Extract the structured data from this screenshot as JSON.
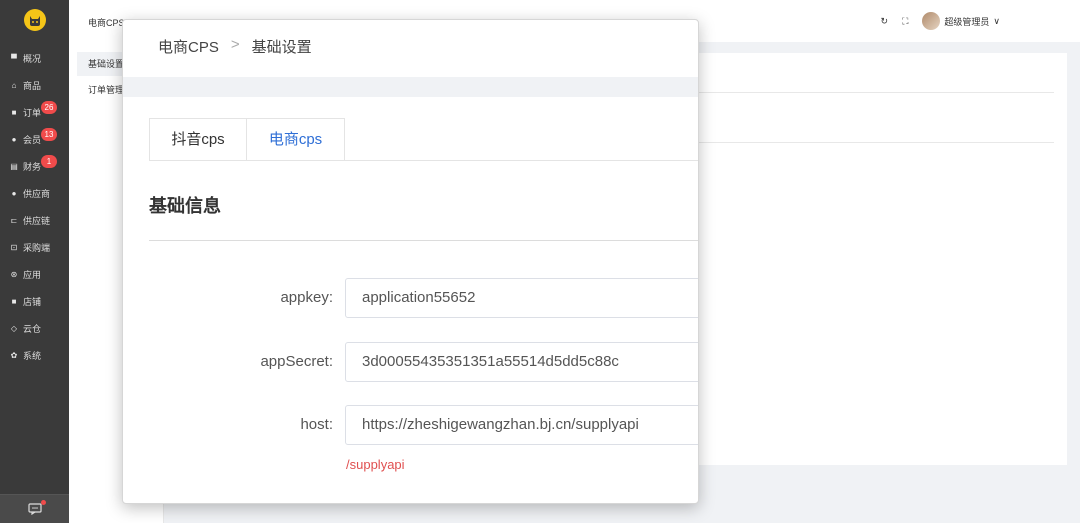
{
  "sidebar": {
    "items": [
      {
        "label": "概况",
        "icon": "monitor-icon",
        "glyph": "▀"
      },
      {
        "label": "商品",
        "icon": "shop-icon",
        "glyph": "⌂"
      },
      {
        "label": "订单",
        "icon": "order-icon",
        "glyph": "■",
        "badge": "26"
      },
      {
        "label": "会员",
        "icon": "member-icon",
        "glyph": "●",
        "badge": "13"
      },
      {
        "label": "财务",
        "icon": "finance-icon",
        "glyph": "▤",
        "badge": "1"
      },
      {
        "label": "供应商",
        "icon": "supplier-icon",
        "glyph": "●"
      },
      {
        "label": "供应链",
        "icon": "supply-chain-icon",
        "glyph": "⊏"
      },
      {
        "label": "采购端",
        "icon": "purchase-icon",
        "glyph": "⊡"
      },
      {
        "label": "应用",
        "icon": "apps-icon",
        "glyph": "⊛"
      },
      {
        "label": "店铺",
        "icon": "store-icon",
        "glyph": "■"
      },
      {
        "label": "云仓",
        "icon": "cloud-icon",
        "glyph": "◇"
      },
      {
        "label": "系统",
        "icon": "gear-icon",
        "glyph": "✿"
      }
    ]
  },
  "subpanel": {
    "title": "电商CPS",
    "items": [
      "基础设置",
      "订单管理"
    ]
  },
  "header": {
    "user_name": "超级管理员",
    "dropdown_glyph": "∨",
    "refresh_glyph": "↻",
    "fullscreen_glyph": "⛶"
  },
  "zoom": {
    "breadcrumb": [
      "电商CPS",
      "基础设置"
    ],
    "breadcrumb_sep": ">",
    "tabs": [
      {
        "label": "抖音cps",
        "active": false
      },
      {
        "label": "电商cps",
        "active": true
      }
    ],
    "section_title": "基础信息",
    "fields": [
      {
        "label": "appkey:",
        "value": "application55652"
      },
      {
        "label": "appSecret:",
        "value": "3d00055435351351a55514d5dd5c88c"
      },
      {
        "label": "host:",
        "value": "https://zheshigewangzhan.bj.cn/supplyapi"
      }
    ],
    "hint": "/supplyapi"
  },
  "colors": {
    "sidebar_bg": "#3a3a3a",
    "accent": "#2f6fd6",
    "badge": "#f04b4b",
    "hint": "#e05050"
  }
}
